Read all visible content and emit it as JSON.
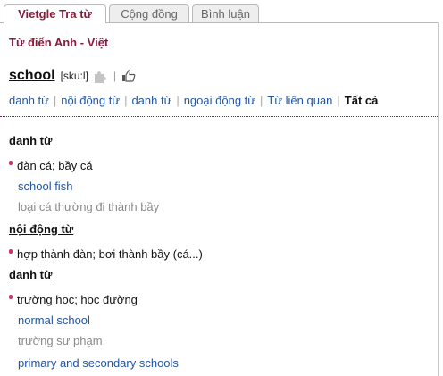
{
  "tabs": [
    {
      "label": "Vietgle Tra từ"
    },
    {
      "label": "Cộng đồng"
    },
    {
      "label": "Bình luận"
    }
  ],
  "dictionary": {
    "title": "Từ điển Anh - Việt"
  },
  "entry": {
    "word": "school",
    "pronunciation": "[sku:l]"
  },
  "pos_nav": [
    "danh từ",
    "nội động từ",
    "danh từ",
    "ngoại động từ",
    "Từ liên quan",
    "Tất cả"
  ],
  "sections": [
    {
      "pos": "danh từ",
      "meaning": "đàn cá; bầy cá",
      "examples": [
        {
          "en": "school fish",
          "vi": "loại cá thường đi thành bầy"
        }
      ]
    },
    {
      "pos": "nội động từ",
      "meaning": "hợp thành đàn; bơi thành bầy (cá...)"
    },
    {
      "pos": "danh từ",
      "meaning": "trường học; học đường",
      "examples": [
        {
          "en": "normal school",
          "vi": "trường sư phạm"
        },
        {
          "en": "primary and secondary schools"
        }
      ]
    }
  ],
  "colors": {
    "accent": "#8b1a3a",
    "link": "#2255a4",
    "bullet": "#d0306a",
    "muted": "#8a8a8a"
  },
  "icons": [
    "puzzle-icon",
    "thumbs-up-icon"
  ]
}
